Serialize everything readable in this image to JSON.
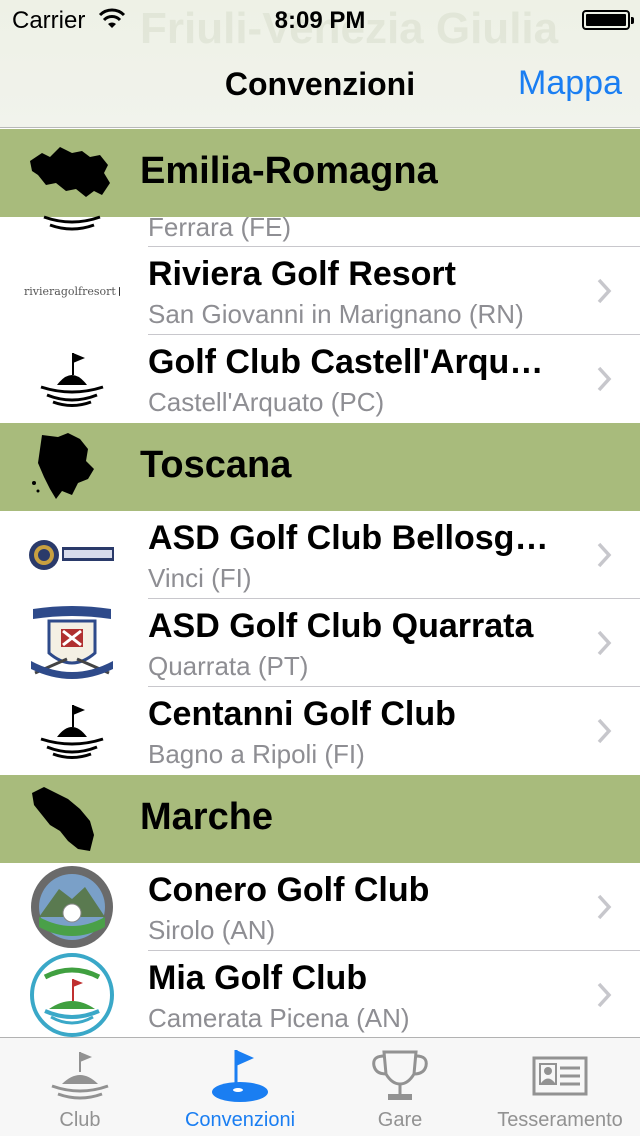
{
  "status_bar": {
    "carrier": "Carrier",
    "time": "8:09 PM"
  },
  "nav": {
    "title": "Convenzioni",
    "right_button": "Mappa",
    "background_title": "Friuli-Venezia Giulia"
  },
  "sections": [
    {
      "region": "Emilia-Romagna",
      "rows": [
        {
          "name": "",
          "location": "Ferrara (FE)",
          "logo": "golf-flag-icon",
          "partial": true
        },
        {
          "name": "Riviera Golf Resort",
          "location": "San Giovanni in Marignano (RN)",
          "logo": "rivieragolfresort"
        },
        {
          "name": "Golf Club Castell'Arquato",
          "location": "Castell'Arquato (PC)",
          "logo": "golf-flag-icon"
        }
      ]
    },
    {
      "region": "Toscana",
      "rows": [
        {
          "name": "ASD Golf Club Bellosguardo",
          "location": "Vinci (FI)",
          "logo": "bellosguardo-crest"
        },
        {
          "name": "ASD Golf Club Quarrata",
          "location": "Quarrata (PT)",
          "logo": "quarrata-crest"
        },
        {
          "name": "Centanni Golf Club",
          "location": "Bagno a Ripoli (FI)",
          "logo": "golf-flag-icon"
        }
      ]
    },
    {
      "region": "Marche",
      "rows": [
        {
          "name": "Conero Golf Club",
          "location": "Sirolo (AN)",
          "logo": "conero-badge"
        },
        {
          "name": "Mia Golf Club",
          "location": "Camerata Picena (AN)",
          "logo": "mia-badge"
        }
      ]
    }
  ],
  "logo_text": {
    "riviera": "rivieragolfresort"
  },
  "tabs": [
    {
      "label": "Club",
      "icon": "golf-hill-icon",
      "active": false
    },
    {
      "label": "Convenzioni",
      "icon": "golf-flag-blue-icon",
      "active": true
    },
    {
      "label": "Gare",
      "icon": "trophy-icon",
      "active": false
    },
    {
      "label": "Tesseramento",
      "icon": "id-card-icon",
      "active": false
    }
  ],
  "colors": {
    "accent": "#1a7ef2",
    "section_bg": "#a8bb7c",
    "secondary_text": "#8e8e93"
  }
}
